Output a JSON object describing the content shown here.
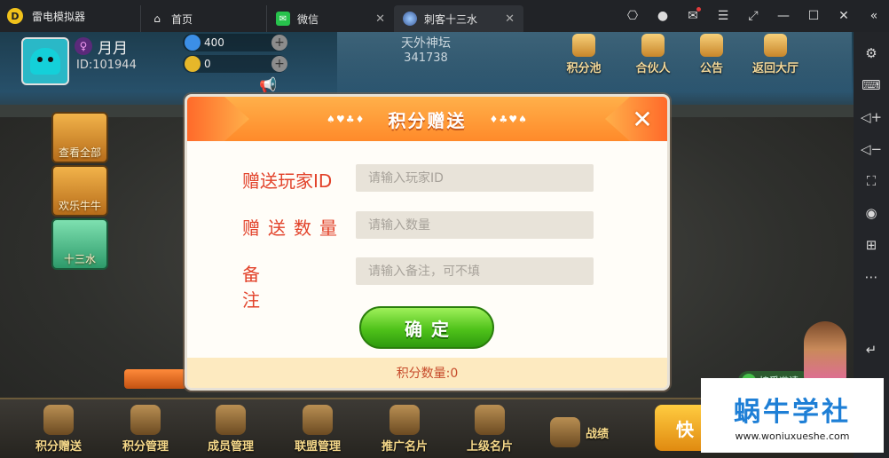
{
  "titlebar": {
    "app_name": "雷电模拟器",
    "tabs": [
      {
        "label": "首页",
        "icon": "home-icon"
      },
      {
        "label": "微信",
        "icon": "wechat-icon"
      },
      {
        "label": "刺客十三水",
        "icon": "game-icon"
      }
    ],
    "controls": [
      "gamepad-icon",
      "user-icon",
      "mail-icon",
      "menu-icon",
      "expand-icon",
      "minimize-icon",
      "maximize-icon",
      "close-icon",
      "collapse-icon"
    ]
  },
  "sidebar": {
    "tools": [
      "settings-icon",
      "keyboard-icon",
      "volume-up-icon",
      "volume-down-icon",
      "screenshot-icon",
      "record-icon",
      "add-app-icon",
      "more-icon"
    ],
    "back": "back-icon"
  },
  "game": {
    "player": {
      "nickname": "月月",
      "id": "ID:101944"
    },
    "resources": {
      "diamond": "400",
      "gold": "0"
    },
    "server": {
      "name": "天外神坛",
      "number": "341738"
    },
    "top_buttons": [
      "积分池",
      "合伙人",
      "公告",
      "返回大厅"
    ],
    "left_tiles": [
      "查看全部",
      "欢乐牛牛",
      "十三水"
    ],
    "invite_label": "接受邀请",
    "bottom_buttons": [
      "积分赠送",
      "积分管理",
      "成员管理",
      "联盟管理",
      "推广名片",
      "上级名片",
      "战绩"
    ],
    "quick_label": "快"
  },
  "dialog": {
    "title": "积分赠送",
    "deco_left": "♠♥♣♦",
    "deco_right": "♦♣♥♠",
    "fields": [
      {
        "label": "赠送玩家ID",
        "placeholder": "请输入玩家ID"
      },
      {
        "label": "赠送数量",
        "placeholder": "请输入数量"
      },
      {
        "label": "备注",
        "placeholder": "请输入备注，可不填"
      }
    ],
    "confirm_label": "确定",
    "footer": "积分数量:0"
  },
  "watermark": {
    "title": "蜗牛学社",
    "url": "www.woniuxueshe.com"
  },
  "colors": {
    "dialog_header": "#ff8a2a",
    "label_red": "#e2422a",
    "confirm_green": "#4fc21a",
    "watermark_blue": "#1e7fd6"
  }
}
